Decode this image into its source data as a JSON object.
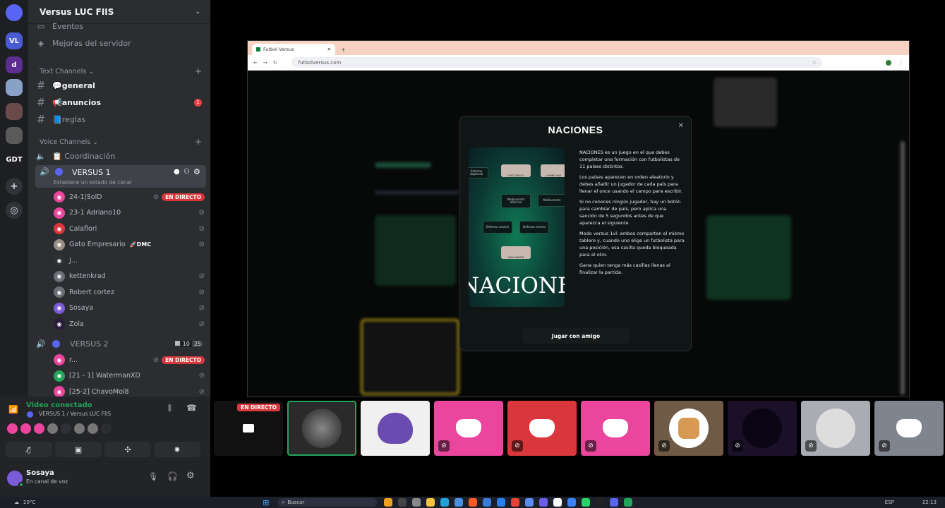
{
  "servers": [
    {
      "name": "discord-home",
      "label": "",
      "badge": "1",
      "color": "#5865f2"
    },
    {
      "name": "server-vl",
      "label": "VL",
      "badge": "1",
      "color": "#4a5bd4"
    },
    {
      "name": "server-d",
      "label": "d",
      "badge": "6",
      "color": "#5c2e91"
    },
    {
      "name": "server-bird",
      "label": "",
      "badge": "",
      "color": "#8aa1c7"
    },
    {
      "name": "server-anime",
      "label": "",
      "badge": "3",
      "color": "#6b4a4a"
    },
    {
      "name": "server-dog",
      "label": "",
      "badge": "",
      "color": "#5a5a5a"
    },
    {
      "name": "server-gdt",
      "label": "GDT",
      "badge": "",
      "color": "#1e1f22"
    }
  ],
  "server_name": "Versus LUC FIIS",
  "channels": {
    "eventos": "Eventos",
    "mejoras": "Mejoras del servidor",
    "text_category": "Text Channels",
    "text": [
      {
        "name": "💬general",
        "badge": ""
      },
      {
        "name": "📢anuncios",
        "badge": "1"
      },
      {
        "name": "📘reglas",
        "badge": ""
      }
    ],
    "voice_category": "Voice Channels",
    "coordinacion": "📋 Coordinación",
    "versus1": "VERSUS 1",
    "versus1_status": "Establece un estado de canal",
    "users1": [
      {
        "name": "24-1|SolD",
        "live": "EN DIRECTO",
        "color": "#eb459e"
      },
      {
        "name": "23-1 Adriano10",
        "live": "",
        "color": "#eb459e"
      },
      {
        "name": "Calaflori",
        "live": "",
        "color": "#da373c"
      },
      {
        "name": "Gato Empresario",
        "live": "",
        "color": "#9a8f86",
        "tag": "🚀DMC"
      },
      {
        "name": "J...",
        "live": "",
        "color": "#2f3136"
      },
      {
        "name": "kettenkrad",
        "live": "",
        "color": "#6d6f78"
      },
      {
        "name": "Robert cortez",
        "live": "",
        "color": "#6d6f78"
      },
      {
        "name": "Sosaya",
        "live": "",
        "color": "#7c5bd6"
      },
      {
        "name": "Zola",
        "live": "",
        "color": "#2b1d3a"
      }
    ],
    "versus2": "VERSUS 2",
    "versus2_count": "10",
    "versus2_limit": "25",
    "users2": [
      {
        "name": "r...",
        "live": "EN DIRECTO",
        "color": "#eb459e"
      },
      {
        "name": "[21 - 1] WatermanXD",
        "live": "",
        "color": "#23a55a"
      },
      {
        "name": "[25-2] ChavoMol8",
        "live": "",
        "color": "#eb459e"
      }
    ]
  },
  "voice": {
    "status": "Video conectado",
    "location": "VERSUS 1 / Versus LUC FIIS"
  },
  "user": {
    "name": "Sosaya",
    "status": "En canal de voz"
  },
  "browser": {
    "tab_title": "Futbol Versus",
    "url": "futbolversus.com"
  },
  "modal": {
    "title": "NACIONES",
    "image_word": "NACIONES",
    "image_slots": [
      "Extremo izquierdo",
      "CRISTIANO R.",
      "LAMINE YAM",
      "Mediocentro ofensivo",
      "Mediocentro",
      "Defensa central",
      "Defensa central",
      "IVAN MARTIN"
    ],
    "paragraphs": [
      "NACIONES es un juego en el que debes completar una formación con futbolistas de 11 países distintos.",
      "Los países aparecen en orden aleatorio y debes añadir un jugador de cada país para llenar el once usando el campo para escribir.",
      "Si no conoces ningún jugador, hay un botón para cambiar de país, pero aplica una sanción de 5 segundos antes de que aparezca el siguiente.",
      "Modo versus 1vl: ambos comparten el mismo tablero y, cuando uno elige un futbolista para una posición, esa casilla queda bloqueada para el otro.",
      "Gana quien tenga más casillas llenas al finalizar la partida."
    ],
    "button": "Jugar con amigo"
  },
  "tiles": [
    {
      "name": "tile-stream",
      "bg": "#111",
      "live": "EN DIRECTO"
    },
    {
      "name": "tile-user-photo",
      "bg": "#2a2a2a",
      "live": ""
    },
    {
      "name": "tile-gengar",
      "bg": "#f0f0f0",
      "live": ""
    },
    {
      "name": "tile-discord-pink-1",
      "bg": "#eb459e",
      "live": ""
    },
    {
      "name": "tile-discord-red",
      "bg": "#da373c",
      "live": ""
    },
    {
      "name": "tile-discord-pink-2",
      "bg": "#eb459e",
      "live": ""
    },
    {
      "name": "tile-cat",
      "bg": "#6e5a45",
      "live": ""
    },
    {
      "name": "tile-dark",
      "bg": "#1a1028",
      "live": ""
    },
    {
      "name": "tile-grey",
      "bg": "#a9adb3",
      "live": ""
    },
    {
      "name": "tile-discord-grey",
      "bg": "#80848e",
      "live": ""
    }
  ],
  "taskbar": {
    "weather": "20°C",
    "search": "Buscar",
    "lang": "ESP",
    "time": "22:13"
  }
}
